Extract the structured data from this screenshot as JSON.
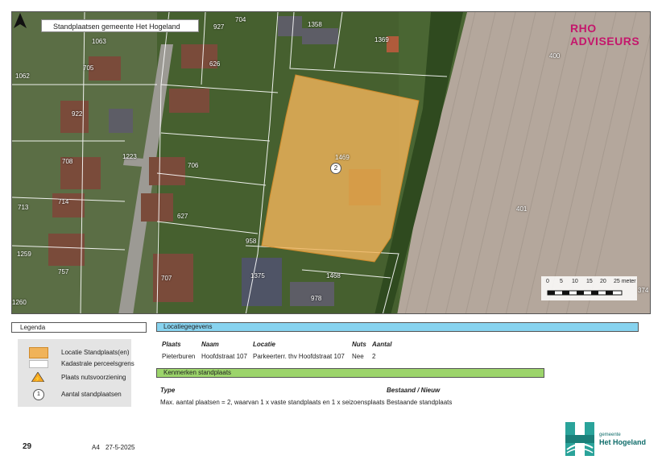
{
  "map": {
    "title": "Standplaatsen gemeente Het Hogeland",
    "brand": "RHO ADVISEURS",
    "parcels": [
      {
        "id": "p927",
        "label": "927"
      },
      {
        "id": "p704",
        "label": "704"
      },
      {
        "id": "p1358",
        "label": "1358"
      },
      {
        "id": "p1369",
        "label": "1369"
      },
      {
        "id": "p400",
        "label": "400"
      },
      {
        "id": "p1062",
        "label": "1062"
      },
      {
        "id": "p705",
        "label": "705"
      },
      {
        "id": "p626",
        "label": "626"
      },
      {
        "id": "p922",
        "label": "922"
      },
      {
        "id": "p1223",
        "label": "1223"
      },
      {
        "id": "p1469",
        "label": "1469"
      },
      {
        "id": "p708",
        "label": "708"
      },
      {
        "id": "p706",
        "label": "706"
      },
      {
        "id": "p714",
        "label": "714"
      },
      {
        "id": "p713",
        "label": "713"
      },
      {
        "id": "p627",
        "label": "627"
      },
      {
        "id": "p401",
        "label": "401"
      },
      {
        "id": "p958",
        "label": "958"
      },
      {
        "id": "p1375",
        "label": "1375"
      },
      {
        "id": "p1468",
        "label": "1468"
      },
      {
        "id": "p707",
        "label": "707"
      },
      {
        "id": "p757",
        "label": "757"
      },
      {
        "id": "p978",
        "label": "978"
      },
      {
        "id": "p374",
        "label": "374"
      },
      {
        "id": "p1260",
        "label": "1260"
      },
      {
        "id": "p1259",
        "label": "1259"
      },
      {
        "id": "p1063",
        "label": "1063"
      }
    ],
    "site_marker": "2",
    "scale": {
      "labels": [
        "0",
        "5",
        "10",
        "15",
        "20",
        "25 meter"
      ]
    }
  },
  "legend": {
    "title": "Legenda",
    "items": [
      {
        "label": "Locatie Standplaats(en)",
        "symbol": "orange-fill",
        "color": "#f0b35a"
      },
      {
        "label": "Kadastrale perceelsgrens",
        "symbol": "white-outline",
        "color": "#ffffff"
      },
      {
        "label": "Plaats nutsvoorziening",
        "symbol": "warning-icon",
        "color": "#f5a623"
      },
      {
        "label": "Aantal standplaatsen",
        "symbol": "circle-1",
        "value": "1"
      }
    ]
  },
  "locatie": {
    "title": "Locatiegegevens",
    "headers": [
      "Plaats",
      "Naam",
      "Locatie",
      "Nuts",
      "Aantal"
    ],
    "row": [
      "Pieterburen",
      "Hoofdstraat 107",
      "Parkeerterr. thv Hoofdstraat 107",
      "Nee",
      "2"
    ]
  },
  "kenmerken": {
    "title": "Kenmerken standplaats",
    "headers": [
      "Type",
      "Bestaand / Nieuw"
    ],
    "row": [
      "Max. aantal plaatsen = 2, waarvan 1 x vaste standplaats en 1 x seizoensplaats",
      "Bestaande standplaats"
    ]
  },
  "footer": {
    "page": "29",
    "paper": "A4",
    "date": "27-5-2025",
    "logo_small": "gemeente",
    "logo_big": "Het Hogeland"
  },
  "colors": {
    "site": "#f0b35a",
    "brand": "#c4176c",
    "blue_bar": "#87d3ef",
    "green_bar": "#9cd46b",
    "logo": "#0e6c6a"
  }
}
